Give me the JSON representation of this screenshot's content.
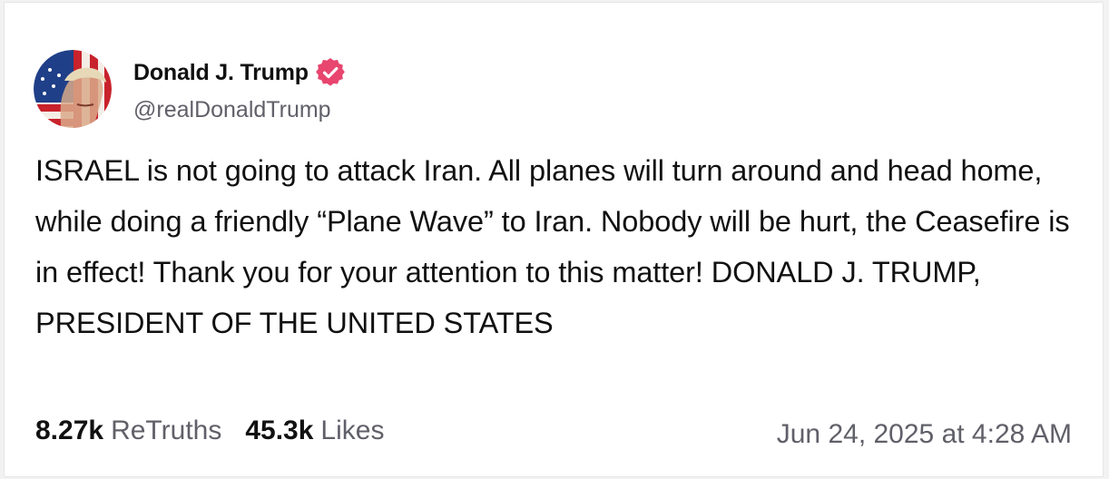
{
  "author": {
    "display_name": "Donald J. Trump",
    "handle": "@realDonaldTrump",
    "verified": true,
    "verified_badge_color": "#e8456f"
  },
  "post": {
    "text": "ISRAEL is not going to attack Iran. All planes will turn around and head home, while doing a friendly “Plane Wave” to Iran. Nobody will be hurt, the Ceasefire is in effect! Thank you for your attention to this matter! DONALD J. TRUMP, PRESIDENT OF THE UNITED STATES",
    "retruths_count": "8.27k",
    "retruths_label": "ReTruths",
    "likes_count": "45.3k",
    "likes_label": "Likes",
    "timestamp": "Jun 24, 2025 at 4:28 AM"
  },
  "colors": {
    "text_primary": "#111111",
    "text_secondary": "#606069",
    "background": "#ffffff"
  }
}
